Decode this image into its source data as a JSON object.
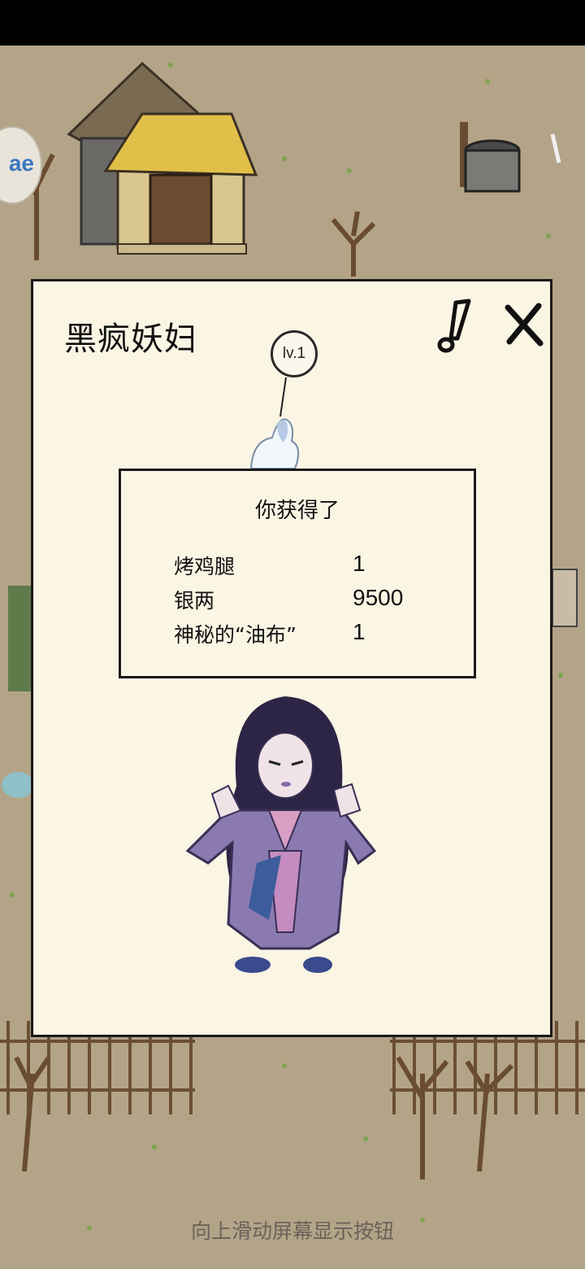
{
  "dialog": {
    "title": "黑疯妖妇",
    "level": "lv.1",
    "reward_title": "你获得了",
    "rewards": [
      {
        "name": "烤鸡腿",
        "qty": "1"
      },
      {
        "name": "银两",
        "qty": "9500"
      },
      {
        "name": "神秘的“油布”",
        "qty": "1"
      }
    ]
  },
  "edge_button": {
    "label": "ae"
  },
  "hint": "向上滑动屏幕显示按钮",
  "colors": {
    "ground": "#b3a488",
    "dialog_bg": "#fbf5e4",
    "border": "#1a1a1a",
    "hint_text": "#6a6258",
    "status_bar": "#000000"
  },
  "icons": [
    "alert-icon",
    "close-icon",
    "level-orb-icon"
  ]
}
